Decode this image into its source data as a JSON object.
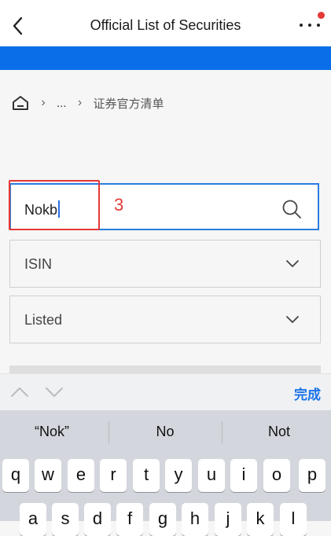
{
  "header": {
    "title": "Official List of Securities"
  },
  "breadcrumb": {
    "ellipsis": "...",
    "current": "证券官方清单"
  },
  "search": {
    "value": "Nokb"
  },
  "annotation": {
    "number": "3"
  },
  "filters": {
    "id_type": "ISIN",
    "status": "Listed"
  },
  "keyboard_toolbar": {
    "done_label": "完成"
  },
  "suggestions": [
    "“Nok”",
    "No",
    "Not"
  ],
  "keyboard": {
    "row1": [
      "q",
      "w",
      "e",
      "r",
      "t",
      "y",
      "u",
      "i",
      "o",
      "p"
    ],
    "row2": [
      "a",
      "s",
      "d",
      "f",
      "g",
      "h",
      "j",
      "k",
      "l"
    ]
  },
  "colors": {
    "accent_blue": "#0a6ee8",
    "annotation_red": "#e53935"
  }
}
